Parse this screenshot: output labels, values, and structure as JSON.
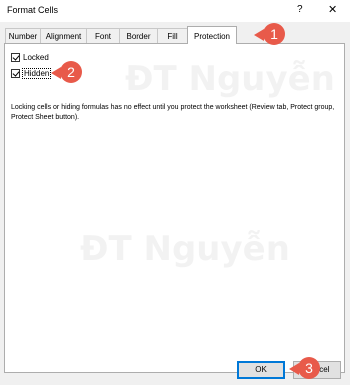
{
  "window": {
    "title": "Format Cells",
    "help_glyph": "?",
    "close_glyph": "✕"
  },
  "tabs": [
    {
      "label": "Number",
      "active": false
    },
    {
      "label": "Alignment",
      "active": false
    },
    {
      "label": "Font",
      "active": false
    },
    {
      "label": "Border",
      "active": false
    },
    {
      "label": "Fill",
      "active": false
    },
    {
      "label": "Protection",
      "active": true
    }
  ],
  "protection": {
    "locked": {
      "label": "Locked",
      "checked": true
    },
    "hidden": {
      "label": "Hidden",
      "checked": true
    },
    "note": "Locking cells or hiding formulas has no effect until you protect the worksheet (Review tab, Protect group, Protect Sheet button)."
  },
  "buttons": {
    "ok_label": "OK",
    "cancel_label": "Cancel"
  },
  "annotations": [
    {
      "number": "1",
      "color": "#e85a4a"
    },
    {
      "number": "2",
      "color": "#e85a4a"
    },
    {
      "number": "3",
      "color": "#e85a4a"
    }
  ],
  "watermark": {
    "text": "ĐT Nguyễn"
  }
}
